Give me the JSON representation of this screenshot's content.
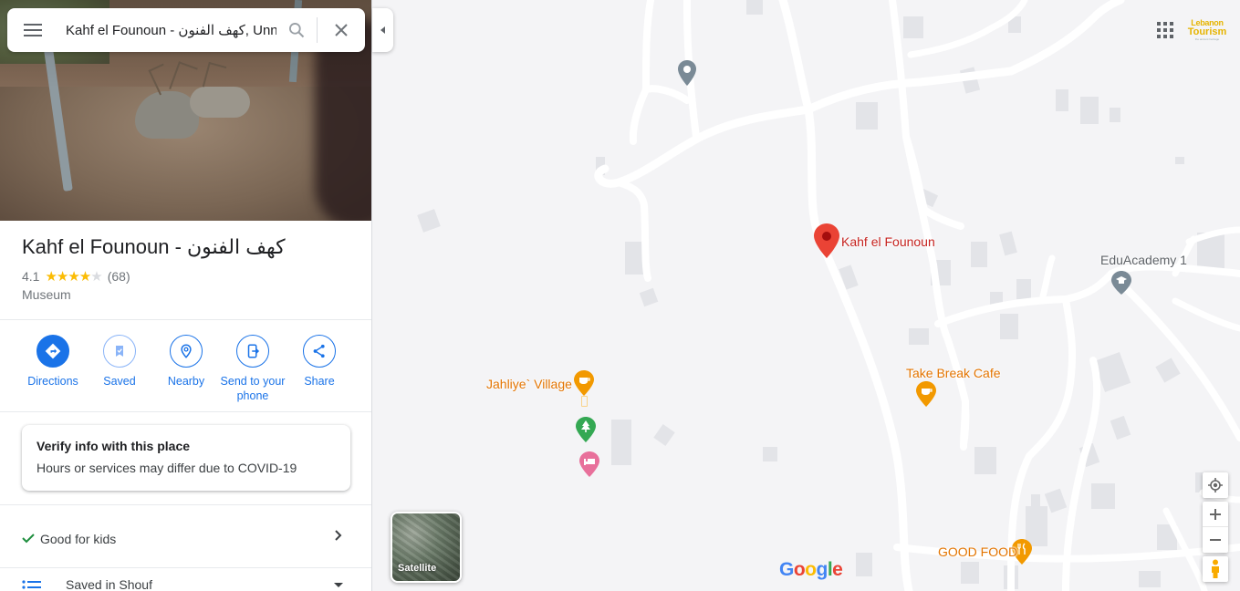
{
  "search": {
    "value": "Kahf el Founoun - كهف الفنون, Unnamed Road"
  },
  "place": {
    "title": "Kahf el Founoun - كهف الفنون",
    "rating": "4.1",
    "rating_stars_filled": 4,
    "reviews": "(68)",
    "category": "Museum"
  },
  "actions": [
    {
      "label": "Directions",
      "icon": "directions-icon"
    },
    {
      "label": "Saved",
      "icon": "bookmark-icon"
    },
    {
      "label": "Nearby",
      "icon": "nearby-icon"
    },
    {
      "label": "Send to your phone",
      "icon": "send-to-phone-icon"
    },
    {
      "label": "Share",
      "icon": "share-icon"
    }
  ],
  "covid": {
    "title": "Verify info with this place",
    "subtitle": "Hours or services may differ due to COVID-19"
  },
  "attributes": {
    "good_for_kids": "Good for kids",
    "saved_in": "Saved in Shouf"
  },
  "map": {
    "pois": {
      "selected": "Kahf el Founoun",
      "eduacademy": "EduAcademy 1",
      "jahliye": "Jahliye` Village",
      "take_break": "Take Break Cafe",
      "good_food": "GOOD FOOD"
    },
    "satellite_label": "Satellite",
    "account_logo": [
      "Lebanon",
      "Tourism",
      "the ancient heritage"
    ],
    "colors": {
      "selected_pin": "#ea4335",
      "food_poi": "#f29900",
      "park_poi": "#34a853",
      "hotel_poi": "#e8709b",
      "generic_poi": "#7a8a96",
      "accent": "#1a73e8"
    }
  }
}
